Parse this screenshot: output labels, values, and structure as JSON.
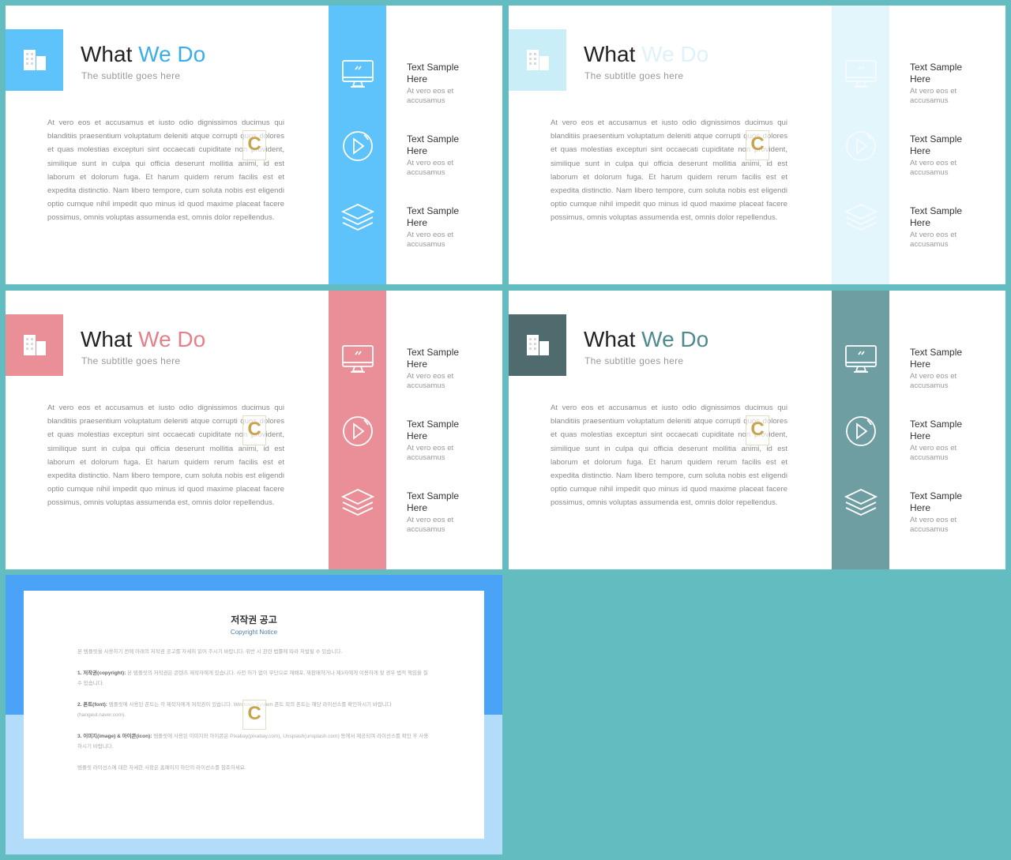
{
  "content": {
    "title_a": "What",
    "title_b": "We Do",
    "subtitle": "The subtitle goes here",
    "body": "At vero eos et accusamus et iusto odio dignissimos ducimus qui blanditiis praesentium voluptatum deleniti atque corrupti quos dolores et quas molestias excepturi sint occaecati cupiditate non provident, similique sunt in culpa qui officia deserunt mollitia animi, id est laborum et dolorum fuga. Et harum quidem rerum facilis est et expedita distinctio. Nam libero tempore, cum soluta nobis est eligendi optio cumque nihil impedit quo minus id quod maxime placeat facere possimus, omnis voluptas assumenda est, omnis dolor repellendus.",
    "items": [
      {
        "icon": "monitor-icon",
        "title": "Text Sample Here",
        "desc": "At vero eos et accusamus"
      },
      {
        "icon": "play-icon",
        "title": "Text Sample Here",
        "desc": "At vero eos et accusamus"
      },
      {
        "icon": "layers-icon",
        "title": "Text Sample Here",
        "desc": "At vero eos et accusamus"
      }
    ],
    "watermark": "C"
  },
  "slides": [
    {
      "box": "#5ec2fb",
      "band": "#5ec2fb",
      "accent": "#3aaee8",
      "icon_stroke": "#ffffff"
    },
    {
      "box": "#c9eef8",
      "band": "#e3f6fb",
      "accent": "#dff2f9",
      "icon_stroke": "#f5fbfd"
    },
    {
      "box": "#ea8f98",
      "band": "#ea8f98",
      "accent": "#e57f8a",
      "icon_stroke": "#ffffff"
    },
    {
      "box": "#4f6b6d",
      "band": "#6e9ea2",
      "accent": "#4f8a8e",
      "icon_stroke": "#ffffff"
    }
  ],
  "notice": {
    "title": "저작권 공고",
    "subtitle": "Copyright Notice",
    "intro": "본 템플릿을 사용하기 전에 아래의 저작권 공고를 자세히 읽어 주시기 바랍니다. 위반 시 관련 법률에 따라 처벌될 수 있습니다.",
    "sections": [
      {
        "label": "1. 저작권(copyright):",
        "text": "본 템플릿의 저작권은 콘텐츠 제작자에게 있습니다. 사전 허가 없이 무단으로 재배포, 재판매하거나 제3자에게 이용하게 할 경우 법적 책임을 질 수 있습니다."
      },
      {
        "label": "2. 폰트(font):",
        "text": "템플릿에 사용된 폰트는 각 제작자에게 저작권이 있습니다. Windows System 폰트 외의 폰트는 해당 라이선스를 확인하시기 바랍니다(hangeul.naver.com)."
      },
      {
        "label": "3. 이미지(image) & 아이콘(icon):",
        "text": "템플릿에 사용된 이미지와 아이콘은 Pixabay(pixabay.com), Unsplash(unsplash.com) 등에서 제공되며 라이선스를 확인 후 사용하시기 바랍니다."
      }
    ],
    "footer": "템플릿 라이선스에 대한 자세한 사항은 홈페이지 하단의 라이선스를 참조하세요."
  }
}
